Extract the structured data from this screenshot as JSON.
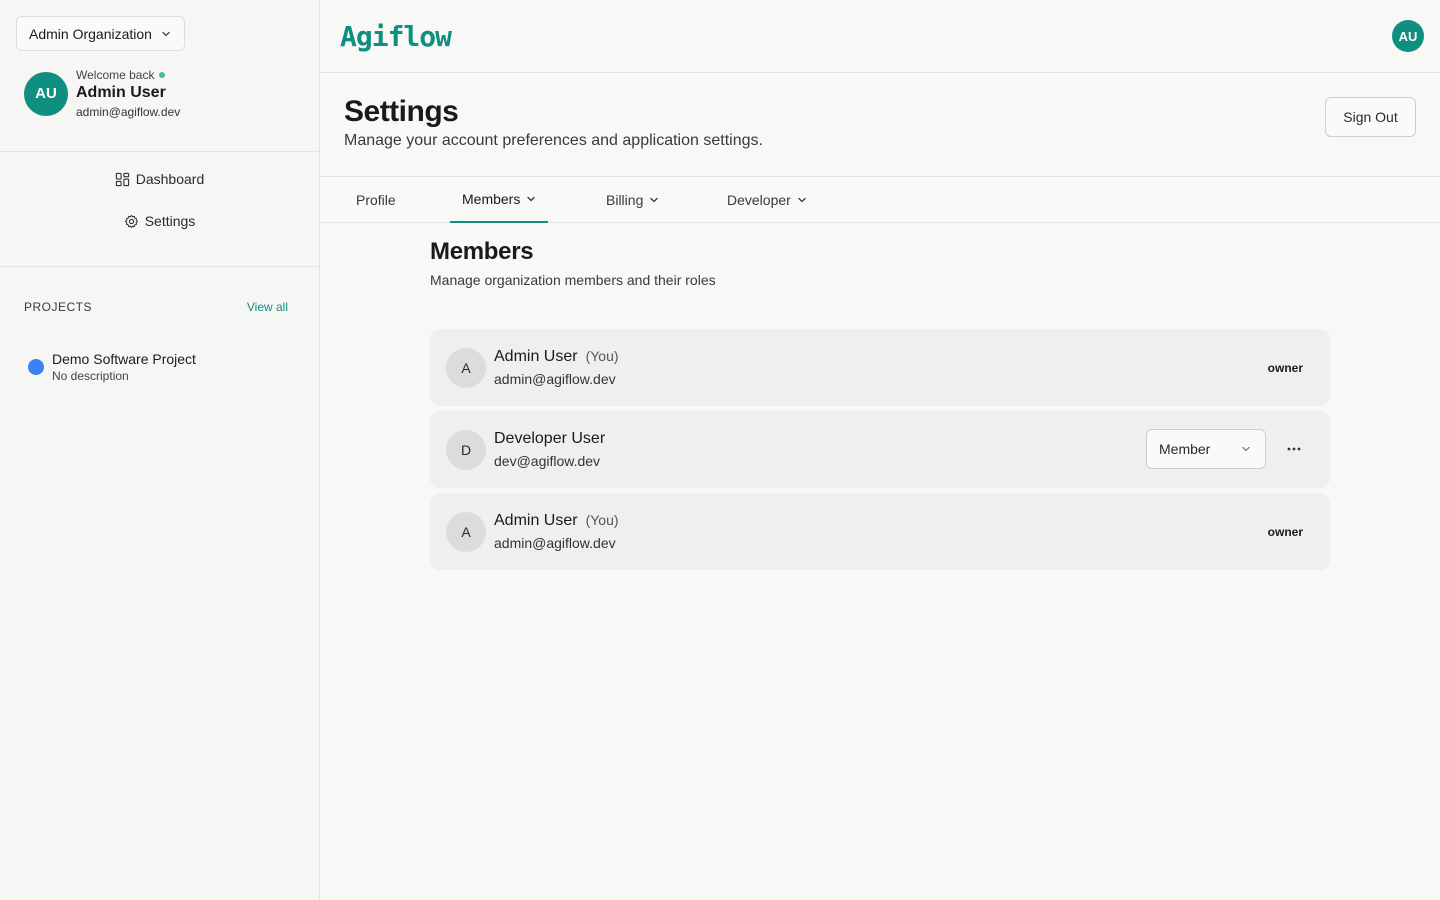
{
  "sidebar": {
    "org_name": "Admin Organization",
    "user": {
      "initials": "AU",
      "welcome": "Welcome back",
      "name": "Admin User",
      "email": "admin@agiflow.dev"
    },
    "nav": [
      {
        "label": "Dashboard",
        "icon": "dashboard-grid-icon"
      },
      {
        "label": "Settings",
        "icon": "gear-icon"
      }
    ],
    "projects": {
      "title": "PROJECTS",
      "view_all": "View all",
      "items": [
        {
          "name": "Demo Software Project",
          "description": "No description",
          "color": "#3b82f6"
        }
      ]
    }
  },
  "topbar": {
    "logo": "Agiflow",
    "avatar_initials": "AU",
    "brand_color": "#0f8f80"
  },
  "header": {
    "title": "Settings",
    "subtitle": "Manage your account preferences and application settings.",
    "signout_label": "Sign Out"
  },
  "tabs": [
    {
      "label": "Profile",
      "has_dropdown": false,
      "active": false
    },
    {
      "label": "Members",
      "has_dropdown": true,
      "active": true
    },
    {
      "label": "Billing",
      "has_dropdown": true,
      "active": false
    },
    {
      "label": "Developer",
      "has_dropdown": true,
      "active": false
    }
  ],
  "members_section": {
    "title": "Members",
    "subtitle": "Manage organization members and their roles",
    "members": [
      {
        "initial": "A",
        "name": "Admin User",
        "you": "(You)",
        "email": "admin@agiflow.dev",
        "role": "owner"
      },
      {
        "initial": "D",
        "name": "Developer User",
        "email": "dev@agiflow.dev",
        "role_select": "Member"
      },
      {
        "initial": "A",
        "name": "Admin User",
        "you": "(You)",
        "email": "admin@agiflow.dev",
        "role": "owner"
      }
    ]
  }
}
